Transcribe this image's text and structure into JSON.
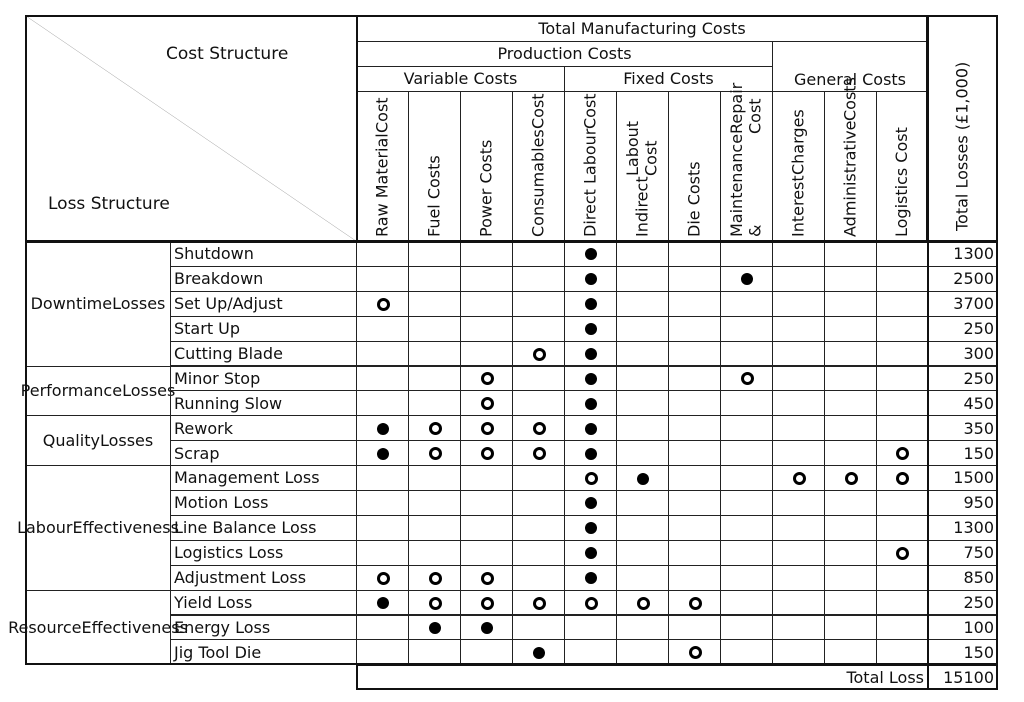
{
  "header": {
    "cost_structure": "Cost Structure",
    "loss_structure": "Loss Structure",
    "total_manufacturing_costs": "Total Manufacturing Costs",
    "production_costs": "Production Costs",
    "variable_costs": "Variable Costs",
    "fixed_costs": "Fixed Costs",
    "general_costs": "General Costs",
    "total_losses": "Total Losses (£1,000)"
  },
  "cost_columns": [
    [
      "Raw Material",
      "Cost"
    ],
    [
      "Fuel Costs"
    ],
    [
      "Power Costs"
    ],
    [
      "Consumables",
      "Cost"
    ],
    [
      "Direct Labour",
      "Cost"
    ],
    [
      "Indirect",
      "Labout Cost"
    ],
    [
      "Die Costs"
    ],
    [
      "Maintenance &",
      "Repair Cost"
    ],
    [
      "Interest",
      "Charges"
    ],
    [
      "Administrative",
      "Costs"
    ],
    [
      "Logistics Cost"
    ]
  ],
  "legend_markers": {
    "F": "filled-circle",
    "O": "open-circle"
  },
  "categories": [
    {
      "label": [
        "Downtime",
        "Losses"
      ],
      "rows": 5
    },
    {
      "label": [
        "Performance",
        "Losses"
      ],
      "rows": 2
    },
    {
      "label": [
        "Quality",
        "Losses"
      ],
      "rows": 2
    },
    {
      "label": [
        "Labour",
        "Effectiveness"
      ],
      "rows": 5
    },
    {
      "label": [
        "Resource",
        "Effectiveness"
      ],
      "rows": 3
    }
  ],
  "rows": [
    {
      "loss": "Shutdown",
      "marks": [
        "",
        "",
        "",
        "",
        "F",
        "",
        "",
        "",
        "",
        "",
        ""
      ],
      "total": "1300"
    },
    {
      "loss": "Breakdown",
      "marks": [
        "",
        "",
        "",
        "",
        "F",
        "",
        "",
        "F",
        "",
        "",
        ""
      ],
      "total": "2500"
    },
    {
      "loss": "Set Up/Adjust",
      "marks": [
        "O",
        "",
        "",
        "",
        "F",
        "",
        "",
        "",
        "",
        "",
        ""
      ],
      "total": "3700"
    },
    {
      "loss": "Start Up",
      "marks": [
        "",
        "",
        "",
        "",
        "F",
        "",
        "",
        "",
        "",
        "",
        ""
      ],
      "total": "250"
    },
    {
      "loss": "Cutting Blade",
      "marks": [
        "",
        "",
        "",
        "O",
        "F",
        "",
        "",
        "",
        "",
        "",
        ""
      ],
      "total": "300"
    },
    {
      "loss": "Minor Stop",
      "marks": [
        "",
        "",
        "O",
        "",
        "F",
        "",
        "",
        "O",
        "",
        "",
        ""
      ],
      "total": "250"
    },
    {
      "loss": "Running Slow",
      "marks": [
        "",
        "",
        "O",
        "",
        "F",
        "",
        "",
        "",
        "",
        "",
        ""
      ],
      "total": "450"
    },
    {
      "loss": "Rework",
      "marks": [
        "F",
        "O",
        "O",
        "O",
        "F",
        "",
        "",
        "",
        "",
        "",
        ""
      ],
      "total": "350"
    },
    {
      "loss": "Scrap",
      "marks": [
        "F",
        "O",
        "O",
        "O",
        "F",
        "",
        "",
        "",
        "",
        "",
        "O"
      ],
      "total": "150"
    },
    {
      "loss": "Management Loss",
      "marks": [
        "",
        "",
        "",
        "",
        "O",
        "F",
        "",
        "",
        "O",
        "O",
        "O"
      ],
      "total": "1500"
    },
    {
      "loss": "Motion Loss",
      "marks": [
        "",
        "",
        "",
        "",
        "F",
        "",
        "",
        "",
        "",
        "",
        ""
      ],
      "total": "950"
    },
    {
      "loss": "Line Balance Loss",
      "marks": [
        "",
        "",
        "",
        "",
        "F",
        "",
        "",
        "",
        "",
        "",
        ""
      ],
      "total": "1300"
    },
    {
      "loss": "Logistics Loss",
      "marks": [
        "",
        "",
        "",
        "",
        "F",
        "",
        "",
        "",
        "",
        "",
        "O"
      ],
      "total": "750"
    },
    {
      "loss": "Adjustment Loss",
      "marks": [
        "O",
        "O",
        "O",
        "",
        "F",
        "",
        "",
        "",
        "",
        "",
        ""
      ],
      "total": "850"
    },
    {
      "loss": "Yield Loss",
      "marks": [
        "F",
        "O",
        "O",
        "O",
        "O",
        "O",
        "O",
        "",
        "",
        "",
        ""
      ],
      "total": "250"
    },
    {
      "loss": "Energy Loss",
      "marks": [
        "",
        "F",
        "F",
        "",
        "",
        "",
        "",
        "",
        "",
        "",
        ""
      ],
      "total": "100"
    },
    {
      "loss": "Jig Tool Die",
      "marks": [
        "",
        "",
        "",
        "F",
        "",
        "",
        "O",
        "",
        "",
        "",
        ""
      ],
      "total": "150"
    }
  ],
  "footer": {
    "total_loss_label": "Total Loss",
    "total_loss_value": "15100"
  }
}
